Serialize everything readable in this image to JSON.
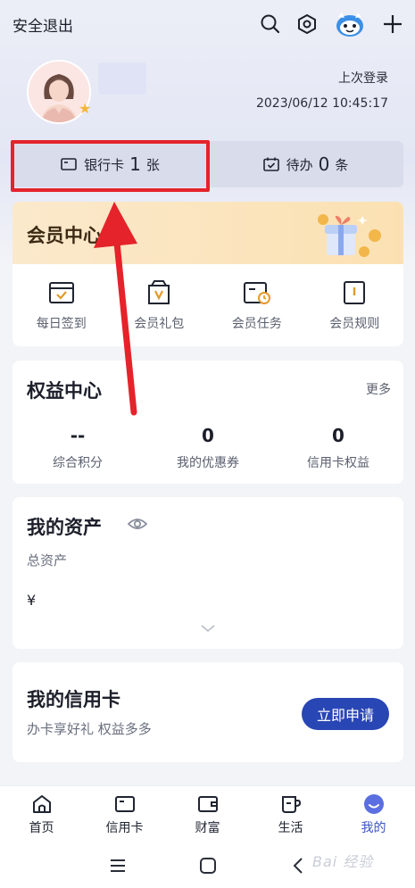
{
  "topbar": {
    "logout_label": "安全退出",
    "icons": [
      "search-icon",
      "settings-hex-icon",
      "mascot-icon",
      "plus-icon"
    ]
  },
  "profile": {
    "vip_icon": "star-icon",
    "last_login_label": "上次登录",
    "last_login_time": "2023/06/12 10:45:17"
  },
  "stats": {
    "bank_card": {
      "label": "银行卡",
      "count": "1",
      "unit": "张"
    },
    "todo": {
      "label": "待办",
      "count": "0",
      "unit": "条"
    }
  },
  "member_center": {
    "title": "会员中心",
    "items": [
      {
        "label": "每日签到",
        "icon": "checkin-icon"
      },
      {
        "label": "会员礼包",
        "icon": "gift-bag-icon"
      },
      {
        "label": "会员任务",
        "icon": "task-icon"
      },
      {
        "label": "会员规则",
        "icon": "rules-book-icon"
      }
    ]
  },
  "benefits": {
    "title": "权益中心",
    "more": "更多",
    "items": [
      {
        "value": "--",
        "label": "综合积分"
      },
      {
        "value": "0",
        "label": "我的优惠券"
      },
      {
        "value": "0",
        "label": "信用卡权益"
      }
    ]
  },
  "assets": {
    "title": "我的资产",
    "total_label": "总资产",
    "value": "¥"
  },
  "credit_card": {
    "title": "我的信用卡",
    "subtitle": "办卡享好礼 权益多多",
    "apply_label": "立即申请"
  },
  "tabbar": [
    {
      "label": "首页",
      "icon": "home-icon"
    },
    {
      "label": "信用卡",
      "icon": "card-icon"
    },
    {
      "label": "财富",
      "icon": "wallet-icon"
    },
    {
      "label": "生活",
      "icon": "cup-icon"
    },
    {
      "label": "我的",
      "icon": "smiley-icon",
      "active": true
    }
  ],
  "watermark": "Bai 经验",
  "colors": {
    "accent": "#2946b5",
    "highlight": "#e4232a",
    "member_gold": "#fbe1b2"
  }
}
